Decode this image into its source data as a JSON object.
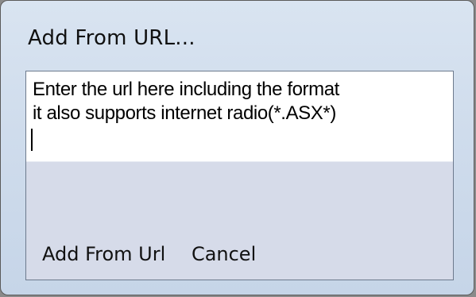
{
  "window": {
    "title": "Add From URL..."
  },
  "url_input": {
    "line1": "Enter the url here including the format",
    "line2": "it also supports internet radio(*.ASX*)"
  },
  "buttons": {
    "add_label": "Add From Url",
    "cancel_label": "Cancel"
  },
  "colors": {
    "frame": "#cfdcec",
    "client": "#d6dbe9",
    "input_bg": "#ffffff"
  }
}
